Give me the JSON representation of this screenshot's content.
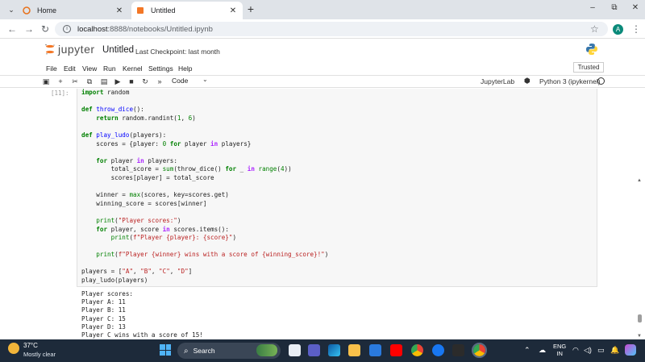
{
  "browser": {
    "tabs": [
      {
        "label": "Home",
        "active": false
      },
      {
        "label": "Untitled",
        "active": true
      }
    ],
    "new_tab": "+",
    "window_controls": {
      "minimize": "–",
      "maximize": "⧉",
      "close": "✕"
    },
    "url_host": "localhost",
    "url_path": ":8888/notebooks/Untitled.ipynb",
    "profile_initial": "A"
  },
  "jupyter": {
    "brand": "jupyter",
    "notebook_title": "Untitled",
    "checkpoint": "Last Checkpoint: last month",
    "menu": [
      "File",
      "Edit",
      "View",
      "Run",
      "Kernel",
      "Settings",
      "Help"
    ],
    "trusted": "Trusted",
    "cell_type": "Code",
    "jupyterlab_link": "JupyterLab",
    "kernel_name": "Python 3 (ipykernel)",
    "accent": "#f37726"
  },
  "cell": {
    "prompt": "[11]:",
    "code_lines": [
      "import random",
      "",
      "def throw_dice():",
      "    return random.randint(1, 6)",
      "",
      "def play_ludo(players):",
      "    scores = {player: 0 for player in players}",
      "",
      "    for player in players:",
      "        total_score = sum(throw_dice() for _ in range(4))",
      "        scores[player] = total_score",
      "",
      "    winner = max(scores, key=scores.get)",
      "    winning_score = scores[winner]",
      "",
      "    print(\"Player scores:\")",
      "    for player, score in scores.items():",
      "        print(f\"Player {player}: {score}\")",
      "",
      "    print(f\"Player {winner} wins with a score of {winning_score}!\")",
      "",
      "players = [\"A\", \"B\", \"C\", \"D\"]",
      "play_ludo(players)"
    ],
    "output_lines": [
      "Player scores:",
      "Player A: 11",
      "Player B: 11",
      "Player C: 15",
      "Player D: 13",
      "Player C wins with a score of 15!"
    ]
  },
  "taskbar": {
    "temperature": "37°C",
    "weather": "Mostly clear",
    "search_label": "Search",
    "language": "ENG",
    "region": "IN"
  }
}
